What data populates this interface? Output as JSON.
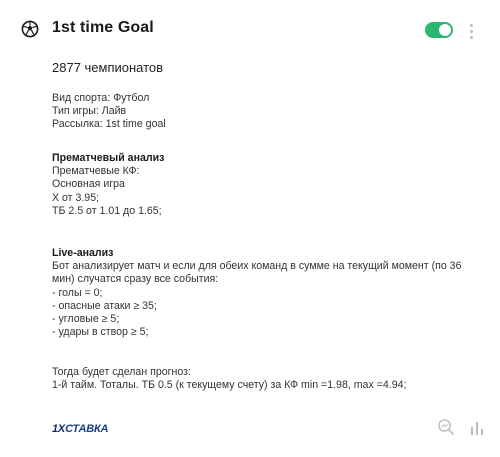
{
  "card": {
    "title": "1st time Goal",
    "toggle_on": true,
    "championships": "2877 чемпионатов",
    "info": {
      "lines": [
        "Вид спорта: Футбол",
        "Тип игры: Лайв",
        "Рассылка: 1st time goal"
      ]
    },
    "prematch": {
      "heading": "Прематчевый анализ",
      "lines": [
        "Прематчевые КФ:",
        "Основная игра",
        "Х от 3.95;",
        "ТБ 2.5 от 1.01 до 1.65;"
      ]
    },
    "live": {
      "heading": "Live-анализ",
      "lines": [
        "Бот анализирует матч и если для обеих команд в сумме на текущий момент (по 36",
        "мин) случатся сразу все события:",
        "- голы = 0;",
        "- опасные атаки ≥ 35;",
        "- угловые ≥ 5;",
        "- удары в створ ≥ 5;"
      ]
    },
    "forecast": {
      "lines": [
        "Тогда будет сделан прогноз:",
        "1-й тайм. Тоталы. ТБ 0.5 (к текущему счету) за КФ min =1.98, max =4.94;"
      ]
    },
    "bookmaker_logo": {
      "number": "1X",
      "word": "СТАВКА"
    }
  },
  "colors": {
    "toggle": "#2bb673",
    "logo": "#1a3f87"
  },
  "icons": [
    "soccer-ball-icon",
    "more-vertical-icon",
    "search-chart-icon",
    "bar-chart-icon"
  ]
}
